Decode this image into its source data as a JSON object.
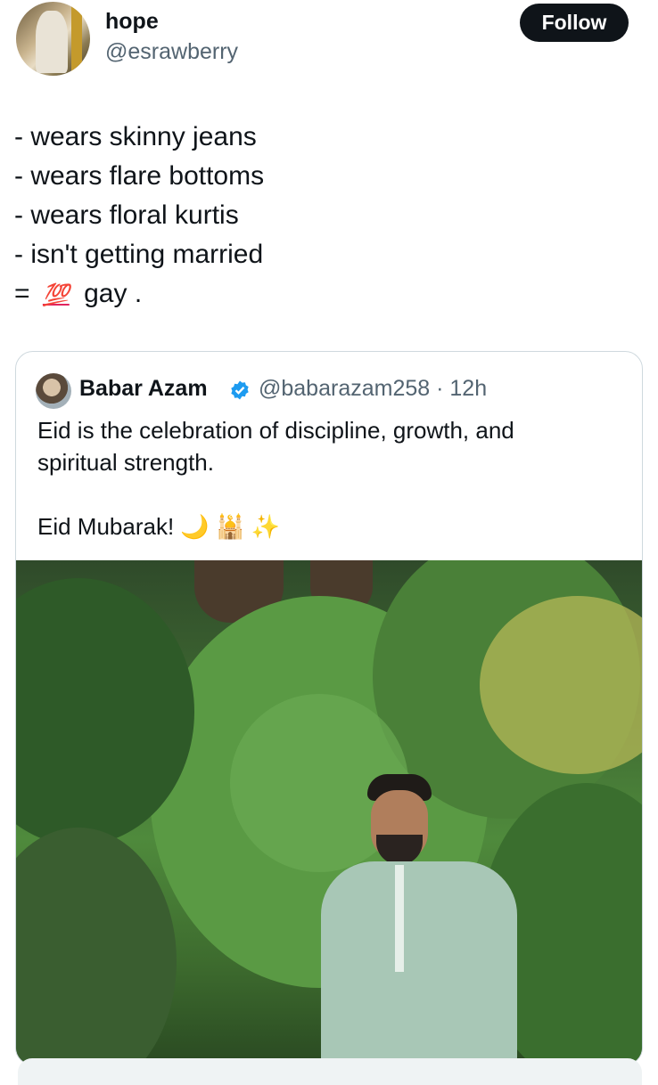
{
  "author": {
    "name": "hope",
    "handle": "@esrawberry",
    "follow_label": "Follow"
  },
  "post": {
    "lines": [
      "- wears skinny jeans",
      "- wears flare bottoms",
      "- wears floral kurtis",
      "- isn't getting married"
    ],
    "last_prefix": "=",
    "last_emoji": "💯",
    "last_suffix": "gay ."
  },
  "quoted": {
    "name": "Babar Azam",
    "handle_time": "@babarazam258 · 12h",
    "text_line1": "Eid is the celebration of discipline, growth, and",
    "text_line2": "spiritual strength.",
    "text_line3": "Eid Mubarak! 🌙 🕌 ✨"
  },
  "colors": {
    "follow_bg": "#0f1419",
    "verified": "#1d9bf0",
    "muted": "#536471"
  }
}
